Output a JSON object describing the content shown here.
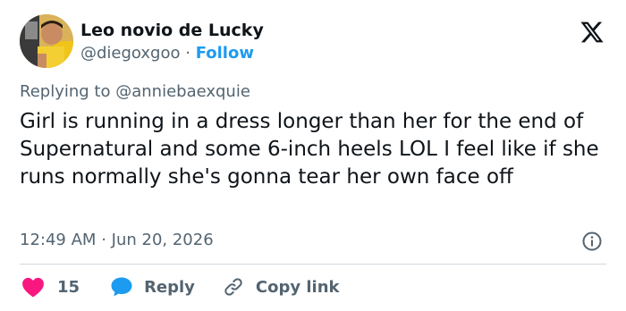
{
  "author": {
    "display_name": "Leo novio de Lucky",
    "handle": "@diegoxgoo",
    "separator": "·",
    "follow_label": "Follow"
  },
  "reply_context": {
    "prefix": "Replying to",
    "mention": "@anniebaexquie"
  },
  "tweet": {
    "text": "Girl is running in a dress longer than her for the end of Supernatural and some 6-inch heels LOL I feel like if she runs normally she's gonna tear her own face off",
    "time": "12:49 AM",
    "separator": "·",
    "date": "Jun 20, 2026"
  },
  "actions": {
    "like_count": "15",
    "reply_label": "Reply",
    "copy_link_label": "Copy link"
  },
  "icons": {
    "logo": "x-logo-icon",
    "info": "info-icon",
    "like": "heart-icon",
    "reply": "speech-bubble-icon",
    "copy": "link-icon"
  },
  "colors": {
    "follow": "#1d9bf0",
    "heart": "#f91880",
    "reply_bubble": "#1d9bf0",
    "secondary_text": "#536471",
    "primary_text": "#0f1419"
  }
}
